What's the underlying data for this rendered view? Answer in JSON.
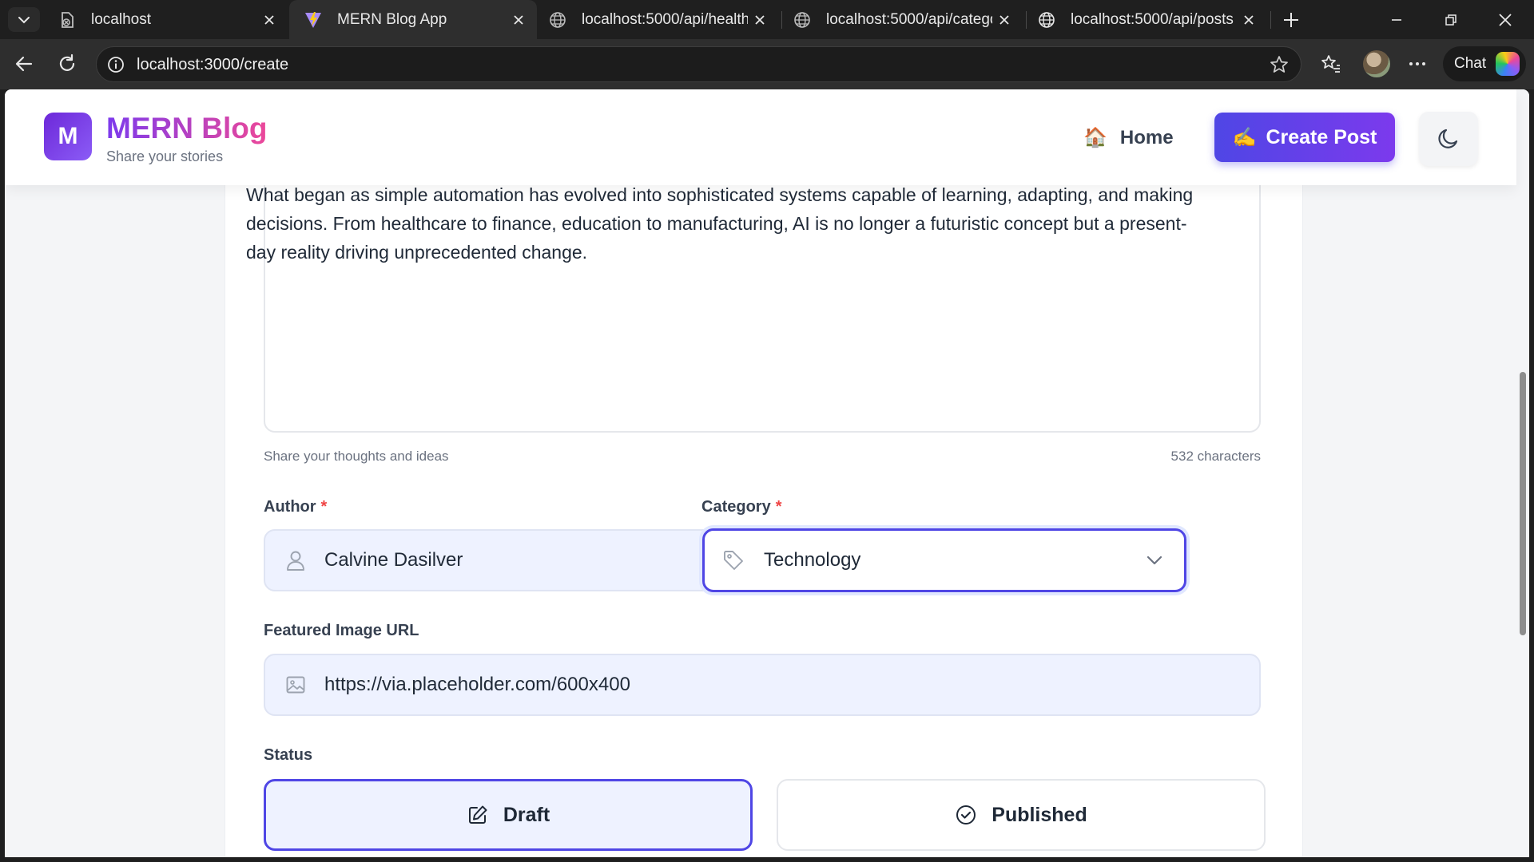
{
  "browser": {
    "tabs": [
      {
        "title": "localhost",
        "active": false
      },
      {
        "title": "MERN Blog App",
        "active": true
      },
      {
        "title": "localhost:5000/api/health",
        "active": false
      },
      {
        "title": "localhost:5000/api/categor",
        "active": false
      },
      {
        "title": "localhost:5000/api/posts",
        "active": false
      }
    ],
    "url": "localhost:3000/create",
    "chat_label": "Chat"
  },
  "header": {
    "logo_letter": "M",
    "brand_title": "MERN Blog",
    "brand_subtitle": "Share your stories",
    "home_icon": "🏠",
    "home_label": "Home",
    "create_icon": "✍️",
    "create_label": "Create Post"
  },
  "content": {
    "text": "What began as simple automation has evolved into sophisticated systems capable of learning, adapting, and making decisions. From healthcare to finance, education to manufacturing, AI is no longer a futuristic concept but a present-day reality driving unprecedented change.",
    "hint": "Share your thoughts and ideas",
    "char_count": "532 characters"
  },
  "author": {
    "label": "Author",
    "required_mark": "*",
    "value": "Calvine Dasilver"
  },
  "category": {
    "label": "Category",
    "required_mark": "*",
    "value": "Technology"
  },
  "image": {
    "label": "Featured Image URL",
    "value": "https://via.placeholder.com/600x400"
  },
  "status": {
    "label": "Status",
    "options": [
      {
        "label": "Draft",
        "selected": true
      },
      {
        "label": "Published",
        "selected": false
      }
    ]
  },
  "colors": {
    "accent": "#4f46e5",
    "brand_gradient_start": "#7c3aed",
    "brand_gradient_end": "#ec4899",
    "required": "#ef4444"
  }
}
